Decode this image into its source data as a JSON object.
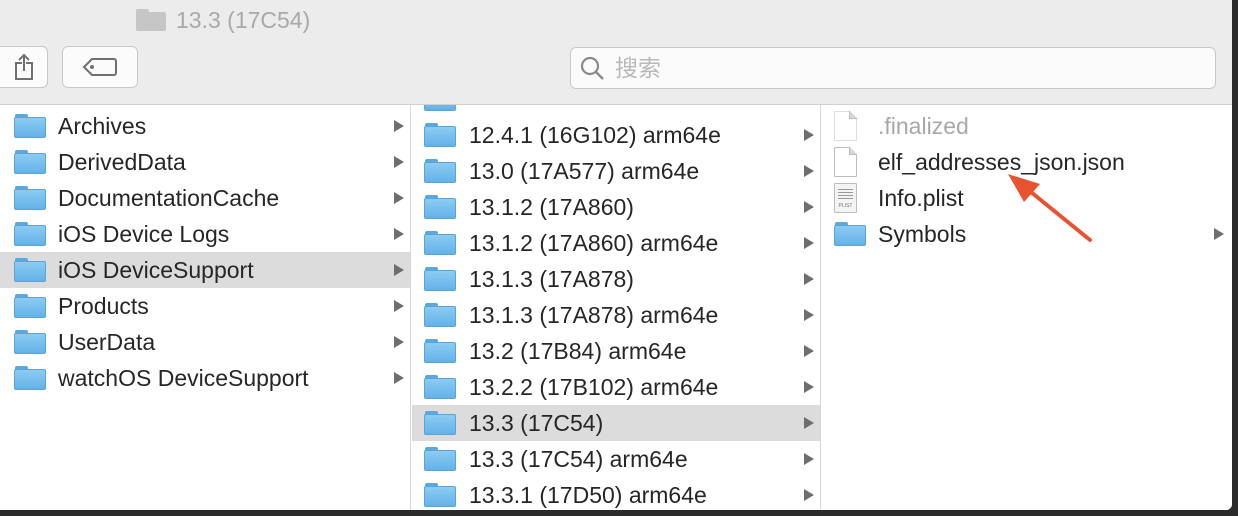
{
  "window": {
    "title": "13.3 (17C54)",
    "title_icon": "folder-icon"
  },
  "toolbar": {
    "share_icon": "share-icon",
    "tag_icon": "tag-icon",
    "search": {
      "value": "",
      "placeholder": "搜索",
      "icon": "magnifier-icon"
    }
  },
  "columns": {
    "col1": {
      "items": [
        {
          "label": "Archives",
          "type": "folder",
          "has_children": true
        },
        {
          "label": "DerivedData",
          "type": "folder",
          "has_children": true
        },
        {
          "label": "DocumentationCache",
          "type": "folder",
          "has_children": true
        },
        {
          "label": "iOS Device Logs",
          "type": "folder",
          "has_children": true
        },
        {
          "label": "iOS DeviceSupport",
          "type": "folder",
          "has_children": true,
          "selected": true
        },
        {
          "label": "Products",
          "type": "folder",
          "has_children": true
        },
        {
          "label": "UserData",
          "type": "folder",
          "has_children": true
        },
        {
          "label": "watchOS DeviceSupport",
          "type": "folder",
          "has_children": true
        }
      ]
    },
    "col2": {
      "items": [
        {
          "label": "12.4.1 (16G102) arm64e",
          "type": "folder",
          "has_children": true
        },
        {
          "label": "13.0 (17A577) arm64e",
          "type": "folder",
          "has_children": true
        },
        {
          "label": "13.1.2 (17A860)",
          "type": "folder",
          "has_children": true
        },
        {
          "label": "13.1.2 (17A860) arm64e",
          "type": "folder",
          "has_children": true
        },
        {
          "label": "13.1.3 (17A878)",
          "type": "folder",
          "has_children": true
        },
        {
          "label": "13.1.3 (17A878) arm64e",
          "type": "folder",
          "has_children": true
        },
        {
          "label": "13.2 (17B84) arm64e",
          "type": "folder",
          "has_children": true
        },
        {
          "label": "13.2.2 (17B102) arm64e",
          "type": "folder",
          "has_children": true
        },
        {
          "label": "13.3 (17C54)",
          "type": "folder",
          "has_children": true,
          "selected": true
        },
        {
          "label": "13.3 (17C54) arm64e",
          "type": "folder",
          "has_children": true
        },
        {
          "label": "13.3.1 (17D50) arm64e",
          "type": "folder",
          "has_children": true
        }
      ]
    },
    "col3": {
      "items": [
        {
          "label": ".finalized",
          "type": "file",
          "faded": true
        },
        {
          "label": "elf_addresses_json.json",
          "type": "file"
        },
        {
          "label": "Info.plist",
          "type": "plist"
        },
        {
          "label": "Symbols",
          "type": "folder",
          "has_children": true
        }
      ]
    }
  },
  "colors": {
    "selection": "#dcdcdc",
    "folder_blue": "#6cb8eb",
    "annotation_arrow": "#e8532f"
  }
}
